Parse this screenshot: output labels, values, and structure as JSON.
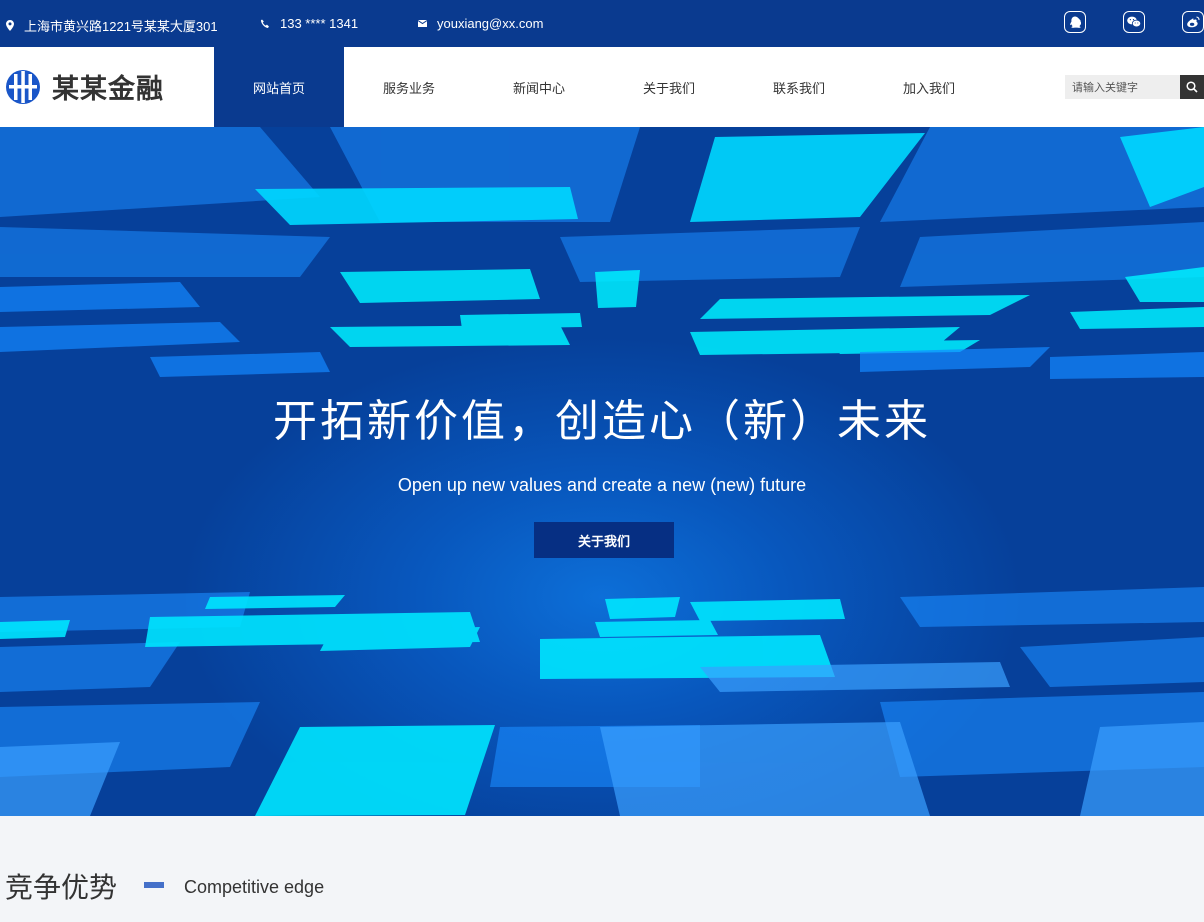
{
  "topbar": {
    "address": "上海市黄兴路1221号某某大厦301",
    "phone": "133 **** 1341",
    "email": "youxiang@xx.com",
    "social_icons": [
      "qq-icon",
      "wechat-icon",
      "weibo-icon"
    ]
  },
  "nav": {
    "logo_text": "某某金融",
    "items": [
      {
        "label": "网站首页",
        "active": true
      },
      {
        "label": "服务业务",
        "active": false
      },
      {
        "label": "新闻中心",
        "active": false
      },
      {
        "label": "关于我们",
        "active": false
      },
      {
        "label": "联系我们",
        "active": false
      },
      {
        "label": "加入我们",
        "active": false
      }
    ],
    "search_placeholder": "请输入关键字"
  },
  "banner": {
    "title": "开拓新价值，创造心（新）未来",
    "subtitle": "Open up new values and create a new (new) future",
    "button_label": "关于我们"
  },
  "section": {
    "title": "竞争优势",
    "subtitle": "Competitive edge"
  },
  "colors": {
    "primary": "#0a3a8f",
    "banner_dark": "#062f83",
    "accent_dash": "#4470c9",
    "tile_cyan": "#00e5ff"
  }
}
